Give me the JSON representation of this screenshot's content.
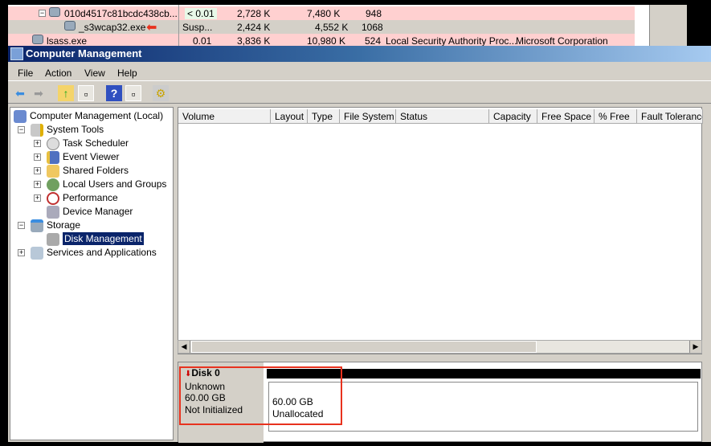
{
  "process_explorer": {
    "rows": [
      {
        "name": "010d4517c81bcdc438cb...",
        "cpu": "< 0.01",
        "private": "2,728 K",
        "working": "7,480 K",
        "pid": "948",
        "desc": "",
        "company": "",
        "color": "#ffd0d0"
      },
      {
        "name": "_s3wcap32.exe",
        "cpu": "Susp...",
        "private": "2,424 K",
        "working": "4,552 K",
        "pid": "1068",
        "desc": "",
        "company": "",
        "color": "#d4d0c8"
      },
      {
        "name": "lsass.exe",
        "cpu": "0.01",
        "private": "3,836 K",
        "working": "10,980 K",
        "pid": "524",
        "desc": "Local Security Authority Proc...",
        "company": "Microsoft Corporation",
        "color": "#ffd0d0"
      }
    ]
  },
  "window": {
    "title": "Computer Management"
  },
  "menu": [
    "File",
    "Action",
    "View",
    "Help"
  ],
  "tree": [
    {
      "label": "Computer Management (Local)",
      "icon": "computer-icon"
    },
    {
      "label": "System Tools",
      "icon": "tools-icon"
    },
    {
      "label": "Task Scheduler",
      "icon": "clock-icon"
    },
    {
      "label": "Event Viewer",
      "icon": "event-viewer-icon"
    },
    {
      "label": "Shared Folders",
      "icon": "shared-folder-icon"
    },
    {
      "label": "Local Users and Groups",
      "icon": "users-icon"
    },
    {
      "label": "Performance",
      "icon": "performance-icon"
    },
    {
      "label": "Device Manager",
      "icon": "device-manager-icon"
    },
    {
      "label": "Storage",
      "icon": "storage-icon"
    },
    {
      "label": "Disk Management",
      "icon": "disk-icon"
    },
    {
      "label": "Services and Applications",
      "icon": "services-icon"
    }
  ],
  "columns": [
    "Volume",
    "Layout",
    "Type",
    "File System",
    "Status",
    "Capacity",
    "Free Space",
    "% Free",
    "Fault Tolerance"
  ],
  "disk": {
    "name": "Disk 0",
    "type": "Unknown",
    "size": "60.00 GB",
    "status": "Not Initialized",
    "partition_size": "60.00 GB",
    "partition_label": "Unallocated"
  },
  "colors": {
    "highlight": "#e8321e",
    "selection": "#0a246a"
  }
}
